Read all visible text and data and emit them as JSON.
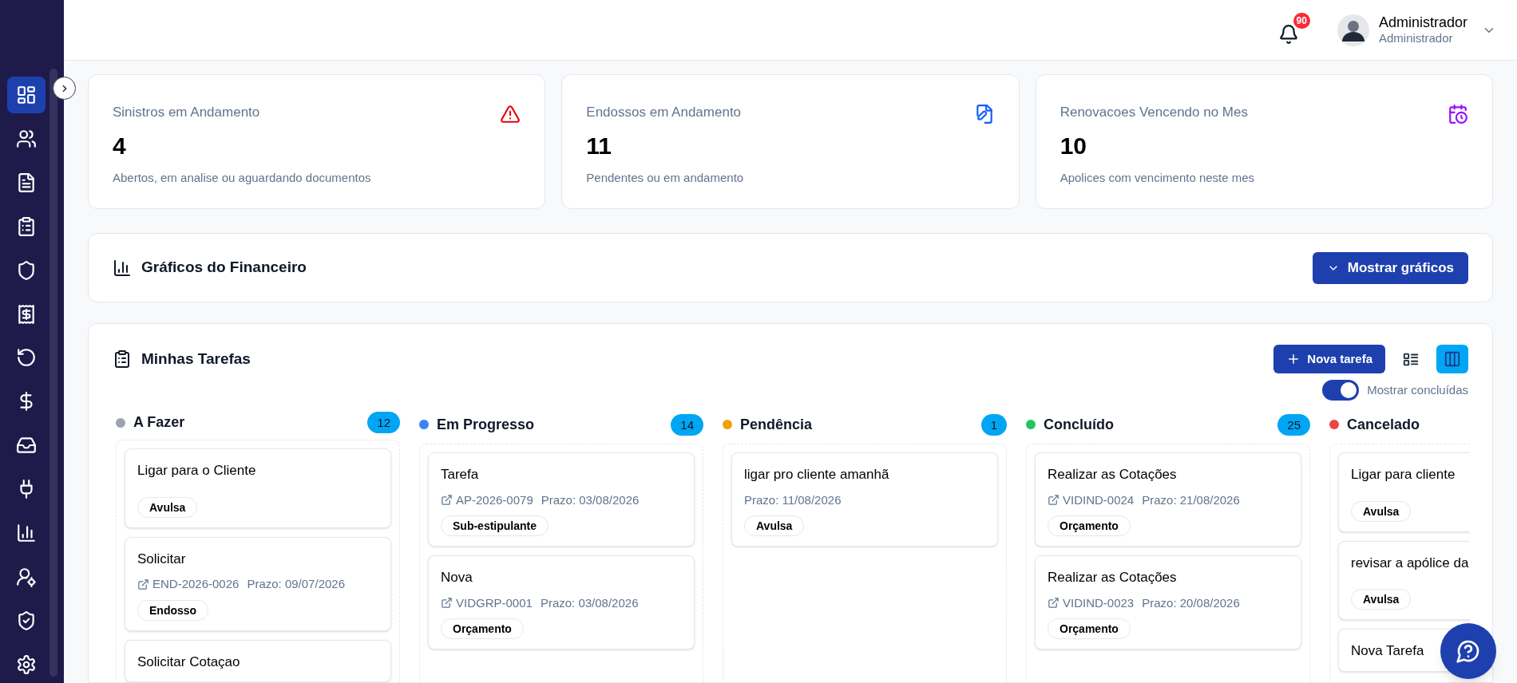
{
  "sidebar": {
    "items": [
      {
        "kind": "dashboard",
        "selected": true
      },
      {
        "kind": "users",
        "selected": false
      },
      {
        "kind": "document",
        "selected": false
      },
      {
        "kind": "clipboard",
        "selected": false
      },
      {
        "kind": "shield",
        "selected": false
      },
      {
        "kind": "receipt",
        "selected": false
      },
      {
        "kind": "rotate",
        "selected": false
      },
      {
        "kind": "dollar",
        "selected": false
      },
      {
        "kind": "inbox",
        "selected": false
      },
      {
        "kind": "plug",
        "selected": false
      },
      {
        "kind": "chart",
        "selected": false
      },
      {
        "kind": "usercog",
        "selected": false
      },
      {
        "kind": "shieldcheck",
        "selected": false
      },
      {
        "kind": "gear",
        "selected": false
      }
    ]
  },
  "header": {
    "notifications": "90",
    "user_name": "Administrador",
    "user_role": "Administrador"
  },
  "metrics": [
    {
      "title": "Sinistros em Andamento",
      "value": "4",
      "note": "Abertos, em analise ou aguardando documentos",
      "kind": "warning"
    },
    {
      "title": "Endossos em Andamento",
      "value": "11",
      "note": "Pendentes ou em andamento",
      "kind": "fileedit"
    },
    {
      "title": "Renovacoes Vencendo no Mes",
      "value": "10",
      "note": "Apolices com vencimento neste mes",
      "kind": "calendarclock"
    }
  ],
  "finance": {
    "title": "Gráficos do Financeiro",
    "button": "Mostrar gráficos"
  },
  "tasks": {
    "title": "Minhas Tarefas",
    "new_button": "Nova tarefa",
    "views": [
      {
        "kind": "list",
        "selected": false
      },
      {
        "kind": "kanban",
        "selected": true
      }
    ],
    "show_done": {
      "label": "Mostrar concluídas",
      "on": true
    },
    "columns": [
      {
        "name": "A Fazer",
        "color": "#9ca3af",
        "count": "12",
        "cards": [
          {
            "title": "Ligar para o Cliente",
            "tag": "Avulsa"
          },
          {
            "title": "Solicitar",
            "ref": "END-2026-0026",
            "due": "Prazo: 09/07/2026",
            "tag": "Endosso"
          },
          {
            "title": "Solicitar Cotaçao"
          }
        ]
      },
      {
        "name": "Em Progresso",
        "color": "#3b82f6",
        "count": "14",
        "cards": [
          {
            "title": "Tarefa",
            "ref": "AP-2026-0079",
            "due": "Prazo: 03/08/2026",
            "tag": "Sub-estipulante"
          },
          {
            "title": "Nova",
            "ref": "VIDGRP-0001",
            "due": "Prazo: 03/08/2026",
            "tag": "Orçamento"
          }
        ]
      },
      {
        "name": "Pendência",
        "color": "#f59e0b",
        "count": "1",
        "cards": [
          {
            "title": "ligar pro cliente amanhã",
            "due": "Prazo: 11/08/2026",
            "tag": "Avulsa"
          }
        ]
      },
      {
        "name": "Concluído",
        "color": "#22c55e",
        "count": "25",
        "cards": [
          {
            "title": "Realizar as Cotações",
            "ref": "VIDIND-0024",
            "due": "Prazo: 21/08/2026",
            "tag": "Orçamento"
          },
          {
            "title": "Realizar as Cotações",
            "ref": "VIDIND-0023",
            "due": "Prazo: 20/08/2026",
            "tag": "Orçamento"
          }
        ]
      },
      {
        "name": "Cancelado",
        "color": "#ef4444",
        "cards": [
          {
            "title": "Ligar para cliente",
            "tag": "Avulsa"
          },
          {
            "title": "revisar a apólice da",
            "tag": "Avulsa"
          },
          {
            "title": "Nova Tarefa"
          }
        ]
      }
    ]
  }
}
